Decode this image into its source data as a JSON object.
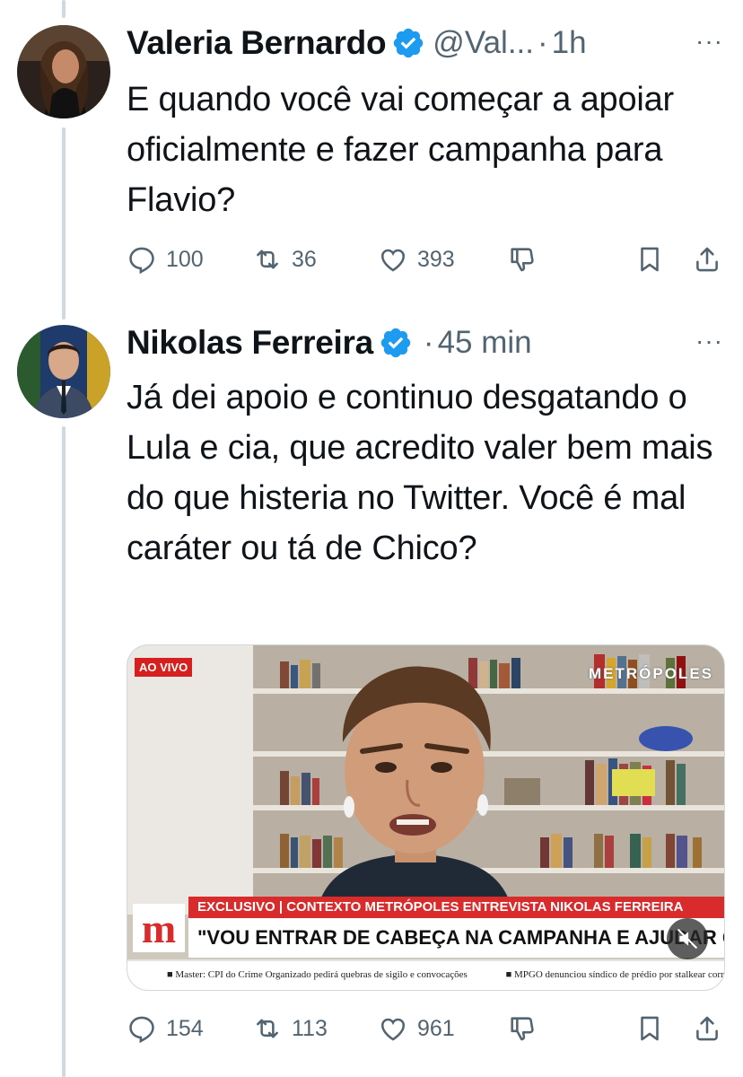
{
  "colors": {
    "verified": "#1d9bf0",
    "muted_text": "#536471",
    "text": "#0f1419",
    "thread_line": "#cfd9de",
    "brand_red": "#d92b2b"
  },
  "tweet1": {
    "name": "Valeria Bernardo",
    "handle": "@Val...",
    "dot": "·",
    "time": "1h",
    "more": "···",
    "text": "E quando você vai começar a apoiar oficialmente e fazer campanha para Flavio?",
    "replies": "100",
    "retweets": "36",
    "likes": "393",
    "icons": [
      "reply-icon",
      "retweet-icon",
      "like-icon",
      "downvote-icon",
      "bookmark-icon",
      "share-icon"
    ]
  },
  "tweet2": {
    "name": "Nikolas Ferreira",
    "dot": "·",
    "time": "45 min",
    "more": "···",
    "text": "Já dei apoio e continuo desgatando o Lula e cia, que acredito valer bem mais do que histeria no Twitter. Você é mal caráter ou tá de Chico?",
    "replies": "154",
    "retweets": "113",
    "likes": "961",
    "video": {
      "live_badge": "AO VIVO",
      "brand_top": "METRÓPOLES",
      "logo_letter": "m",
      "exclusive": "EXCLUSIVO | CONTEXTO METRÓPOLES ENTREVISTA NIKOLAS FERREIRA",
      "headline": "\"VOU ENTRAR DE CABEÇA NA CAMPANHA E AJUDAR QUEM PRECISAR\"",
      "ticker_1": "■ Master: CPI do Crime Organizado pedirá quebras de sigilo e convocações",
      "ticker_2": "■ MPGO denunciou síndico de prédio por stalkear corr"
    }
  }
}
